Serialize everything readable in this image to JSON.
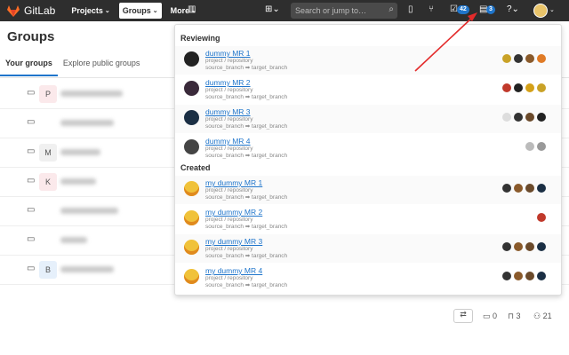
{
  "navbar": {
    "app_name": "GitLab",
    "items": [
      {
        "label": "Projects",
        "active": false
      },
      {
        "label": "Groups",
        "active": true
      },
      {
        "label": "More",
        "active": false
      }
    ],
    "search_placeholder": "Search or jump to…",
    "todo_count": "42",
    "mr_count": "3"
  },
  "page": {
    "title": "Groups",
    "tabs": [
      "Your groups",
      "Explore public groups"
    ]
  },
  "groups": [
    {
      "letter": "P",
      "color": "#fbe9eb"
    },
    {
      "letter": "",
      "color": "#ffffff"
    },
    {
      "letter": "M",
      "color": "#f0f0f0"
    },
    {
      "letter": "K",
      "color": "#fbe9eb"
    },
    {
      "letter": "",
      "color": "#ffffff"
    },
    {
      "letter": "",
      "color": "#ffffff"
    },
    {
      "letter": "B",
      "color": "#e6f0fb"
    }
  ],
  "group_stats": {
    "projects": "0",
    "subgroups": "3",
    "members": "21"
  },
  "dropdown": {
    "reviewing_label": "Reviewing",
    "created_label": "Created",
    "reviewing": [
      {
        "title": "dummy MR 1",
        "project": "project / repository",
        "branches": "source_branch ➡ target_branch"
      },
      {
        "title": "dummy MR 2",
        "project": "project / repository",
        "branches": "source_branch ➡ target_branch"
      },
      {
        "title": "dummy MR 3",
        "project": "project / repository",
        "branches": "source_branch ➡ target_branch"
      },
      {
        "title": "dummy MR 4",
        "project": "project / repository",
        "branches": "source_branch ➡ target_branch"
      }
    ],
    "created": [
      {
        "title": "my dummy MR 1",
        "project": "project / repository",
        "branches": "source_branch ➡ target_branch"
      },
      {
        "title": "my dummy MR 2",
        "project": "project / repository",
        "branches": "source_branch ➡ target_branch"
      },
      {
        "title": "my dummy MR 3",
        "project": "project / repository",
        "branches": "source_branch ➡ target_branch"
      },
      {
        "title": "my dummy MR 4",
        "project": "project / repository",
        "branches": "source_branch ➡ target_branch"
      }
    ]
  },
  "colors": {
    "nav_bg": "#2e2e2e",
    "link": "#1f75cb",
    "annotation_arrow": "#e32b2b"
  }
}
